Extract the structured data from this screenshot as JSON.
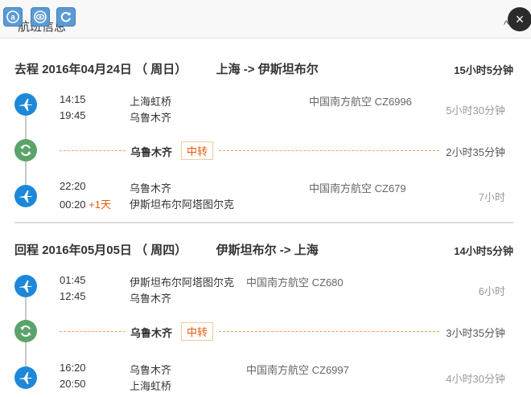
{
  "header": {
    "title": "航班信息",
    "arrow": "^"
  },
  "toolbar_icons": [
    "a-circle-icon",
    "eye-icon",
    "refresh-icon"
  ],
  "close_label": "×",
  "outbound": {
    "label": "去程",
    "date": "2016年04月24日",
    "weekday": "（ 周日）",
    "route": "上海 -> 伊斯坦布尔",
    "total": "15小时5分钟",
    "seg1": {
      "dep_time": "14:15",
      "arr_time": "19:45",
      "dep_city": "上海虹桥",
      "arr_city": "乌鲁木齐",
      "airline": "中国南方航空 CZ6996",
      "duration": "5小时30分钟"
    },
    "transfer": {
      "city": "乌鲁木齐",
      "badge": "中转",
      "duration": "2小时35分钟"
    },
    "seg2": {
      "dep_time": "22:20",
      "arr_time": "00:20",
      "plus": "+1天",
      "dep_city": "乌鲁木齐",
      "arr_city": "伊斯坦布尔阿塔图尔克",
      "airline": "中国南方航空 CZ679",
      "duration": "7小时"
    }
  },
  "return": {
    "label": "回程",
    "date": "2016年05月05日",
    "weekday": "（ 周四）",
    "route": "伊斯坦布尔 -> 上海",
    "total": "14小时5分钟",
    "seg1": {
      "dep_time": "01:45",
      "arr_time": "12:45",
      "dep_city": "伊斯坦布尔阿塔图尔克",
      "arr_city": "乌鲁木齐",
      "airline": "中国南方航空 CZ680",
      "duration": "6小时"
    },
    "transfer": {
      "city": "乌鲁木齐",
      "badge": "中转",
      "duration": "3小时35分钟"
    },
    "seg2": {
      "dep_time": "16:20",
      "arr_time": "20:50",
      "dep_city": "乌鲁木齐",
      "arr_city": "上海虹桥",
      "airline": "中国南方航空 CZ6997",
      "duration": "4小时30分钟"
    }
  },
  "colors": {
    "plane": "#1e88d8",
    "transfer": "#5aa36a",
    "accent": "#e8590c"
  }
}
